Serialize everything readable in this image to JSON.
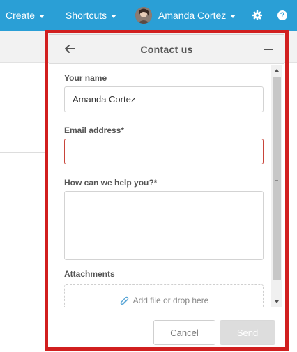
{
  "topbar": {
    "create_label": "Create",
    "shortcuts_label": "Shortcuts",
    "user_name": "Amanda Cortez",
    "help_glyph": "?",
    "background_color": "#2a9fd6"
  },
  "widget": {
    "title": "Contact us",
    "highlight_color": "#d11f1f",
    "fields": {
      "name": {
        "label": "Your name",
        "value": "Amanda Cortez"
      },
      "email": {
        "label": "Email address*",
        "value": "",
        "state": "error"
      },
      "message": {
        "label": "How can we help you?*",
        "value": ""
      }
    },
    "attachments": {
      "label": "Attachments",
      "dropzone_text": "Add file or drop here"
    },
    "footer": {
      "cancel_label": "Cancel",
      "send_label": "Send",
      "send_disabled": true
    }
  },
  "icons": [
    "caret-down-icon",
    "avatar",
    "gear-icon",
    "help-icon",
    "back-arrow-icon",
    "minimize-icon",
    "paperclip-icon"
  ]
}
